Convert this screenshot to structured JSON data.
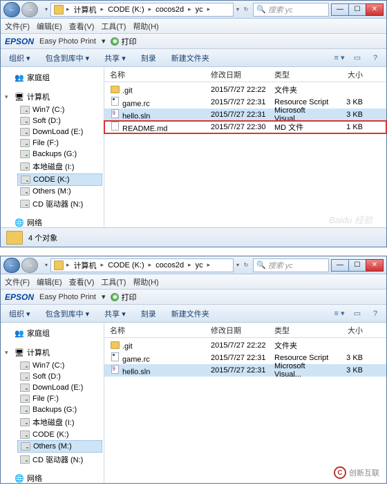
{
  "windows": [
    {
      "breadcrumb": [
        "计算机",
        "CODE (K:)",
        "cocos2d",
        "yc"
      ],
      "search_placeholder": "搜索 yc",
      "menu": [
        "文件(F)",
        "编辑(E)",
        "查看(V)",
        "工具(T)",
        "帮助(H)"
      ],
      "epson": {
        "logo": "EPSON",
        "product": "Easy Photo Print",
        "print": "打印"
      },
      "commands": [
        "组织 ▾",
        "包含到库中 ▾",
        "共享 ▾",
        "刻录",
        "新建文件夹"
      ],
      "sidebar": {
        "homegroup": "家庭组",
        "computer": "计算机",
        "drives": [
          "Win7 (C:)",
          "Soft (D:)",
          "DownLoad (E:)",
          "File (F:)",
          "Backups (G:)",
          "本地磁盘 (I:)",
          "CODE (K:)",
          "Others (M:)",
          "CD 驱动器 (N:)"
        ],
        "selected_drive": 6,
        "network": "网络"
      },
      "columns": {
        "name": "名称",
        "date": "修改日期",
        "type": "类型",
        "size": "大小"
      },
      "files": [
        {
          "icon": "folder",
          "name": ".git",
          "date": "2015/7/27 22:22",
          "type": "文件夹",
          "size": ""
        },
        {
          "icon": "rc",
          "name": "game.rc",
          "date": "2015/7/27 22:31",
          "type": "Resource Script",
          "size": "3 KB"
        },
        {
          "icon": "sln",
          "name": "hello.sln",
          "date": "2015/7/27 22:31",
          "type": "Microsoft Visual...",
          "size": "3 KB",
          "selected": true
        },
        {
          "icon": "doc",
          "name": "README.md",
          "date": "2015/7/27 22:30",
          "type": "MD 文件",
          "size": "1 KB",
          "boxed": true
        }
      ],
      "status": "4 个对象",
      "watermark": "Baidu 经验"
    },
    {
      "breadcrumb": [
        "计算机",
        "CODE (K:)",
        "cocos2d",
        "yc"
      ],
      "search_placeholder": "搜索 yc",
      "menu": [
        "文件(F)",
        "编辑(E)",
        "查看(V)",
        "工具(T)",
        "帮助(H)"
      ],
      "epson": {
        "logo": "EPSON",
        "product": "Easy Photo Print",
        "print": "打印"
      },
      "commands": [
        "组织 ▾",
        "包含到库中 ▾",
        "共享 ▾",
        "刻录",
        "新建文件夹"
      ],
      "sidebar": {
        "homegroup": "家庭组",
        "computer": "计算机",
        "drives": [
          "Win7 (C:)",
          "Soft (D:)",
          "DownLoad (E:)",
          "File (F:)",
          "Backups (G:)",
          "本地磁盘 (I:)",
          "CODE (K:)",
          "Others (M:)",
          "CD 驱动器 (N:)"
        ],
        "selected_drive": 7,
        "network": "网络"
      },
      "columns": {
        "name": "名称",
        "date": "修改日期",
        "type": "类型",
        "size": "大小"
      },
      "files": [
        {
          "icon": "folder",
          "name": ".git",
          "date": "2015/7/27 22:22",
          "type": "文件夹",
          "size": ""
        },
        {
          "icon": "rc",
          "name": "game.rc",
          "date": "2015/7/27 22:31",
          "type": "Resource Script",
          "size": "3 KB"
        },
        {
          "icon": "sln",
          "name": "hello.sln",
          "date": "2015/7/27 22:31",
          "type": "Microsoft Visual...",
          "size": "3 KB",
          "selected": true
        }
      ],
      "status": "",
      "watermark": "创新互联"
    }
  ]
}
